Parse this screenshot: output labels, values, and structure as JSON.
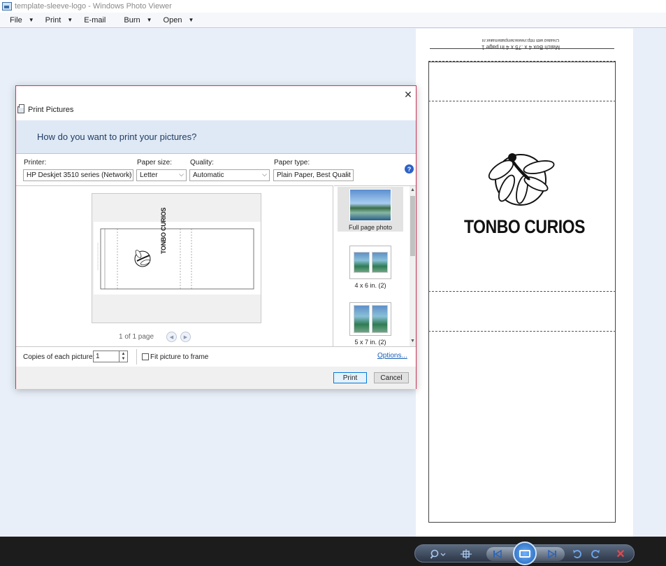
{
  "window": {
    "title": "template-sleeve-logo - Windows Photo Viewer"
  },
  "menu": {
    "items": [
      {
        "label": "File",
        "has_dropdown": true
      },
      {
        "label": "Print",
        "has_dropdown": true
      },
      {
        "label": "E-mail",
        "has_dropdown": false
      },
      {
        "label": "Burn",
        "has_dropdown": true
      },
      {
        "label": "Open",
        "has_dropdown": true
      }
    ],
    "caret": "▼"
  },
  "photo": {
    "created_text": "Created with http://www.templatemaker.nl",
    "template_title": "Match Box 4 x .75 x 4 in page 1",
    "brand_text": "TONBO CURIOS"
  },
  "dialog": {
    "title": "Print Pictures",
    "close_glyph": "✕",
    "question": "How do you want to print your pictures?",
    "printer": {
      "label": "Printer:",
      "value": "HP Deskjet 3510 series (Network)"
    },
    "paper_size": {
      "label": "Paper size:",
      "value": "Letter"
    },
    "quality": {
      "label": "Quality:",
      "value": "Automatic"
    },
    "paper_type": {
      "label": "Paper type:",
      "value": "Plain Paper, Best Qualit"
    },
    "help_glyph": "?",
    "chevron": "⌵",
    "preview": {
      "page_count": "1 of 1 page",
      "brand_text": "TONBO CURIOS",
      "prev_glyph": "◀",
      "next_glyph": "▶"
    },
    "layouts": [
      {
        "label": "Full page photo",
        "selected": true
      },
      {
        "label": "4 x 6 in. (2)",
        "selected": false
      },
      {
        "label": "5 x 7 in. (2)",
        "selected": false
      }
    ],
    "copies": {
      "label": "Copies of each picture:",
      "value": "1"
    },
    "fit_to_frame": {
      "label": "Fit picture to frame",
      "checked": false
    },
    "options_link": "Options...",
    "buttons": {
      "print": "Print",
      "cancel": "Cancel"
    }
  },
  "controls": {
    "icons": [
      "zoom-icon",
      "actual-size-icon",
      "previous-icon",
      "slideshow-icon",
      "next-icon",
      "rotate-left-icon",
      "rotate-right-icon",
      "delete-icon"
    ],
    "delete_glyph": "✕"
  },
  "colors": {
    "dialog_border": "#c8385a",
    "header_band": "#dfe9f6",
    "link": "#1a5fb4",
    "viewer_bg": "#e9eff8",
    "taskbar": "#1c1c1c"
  }
}
